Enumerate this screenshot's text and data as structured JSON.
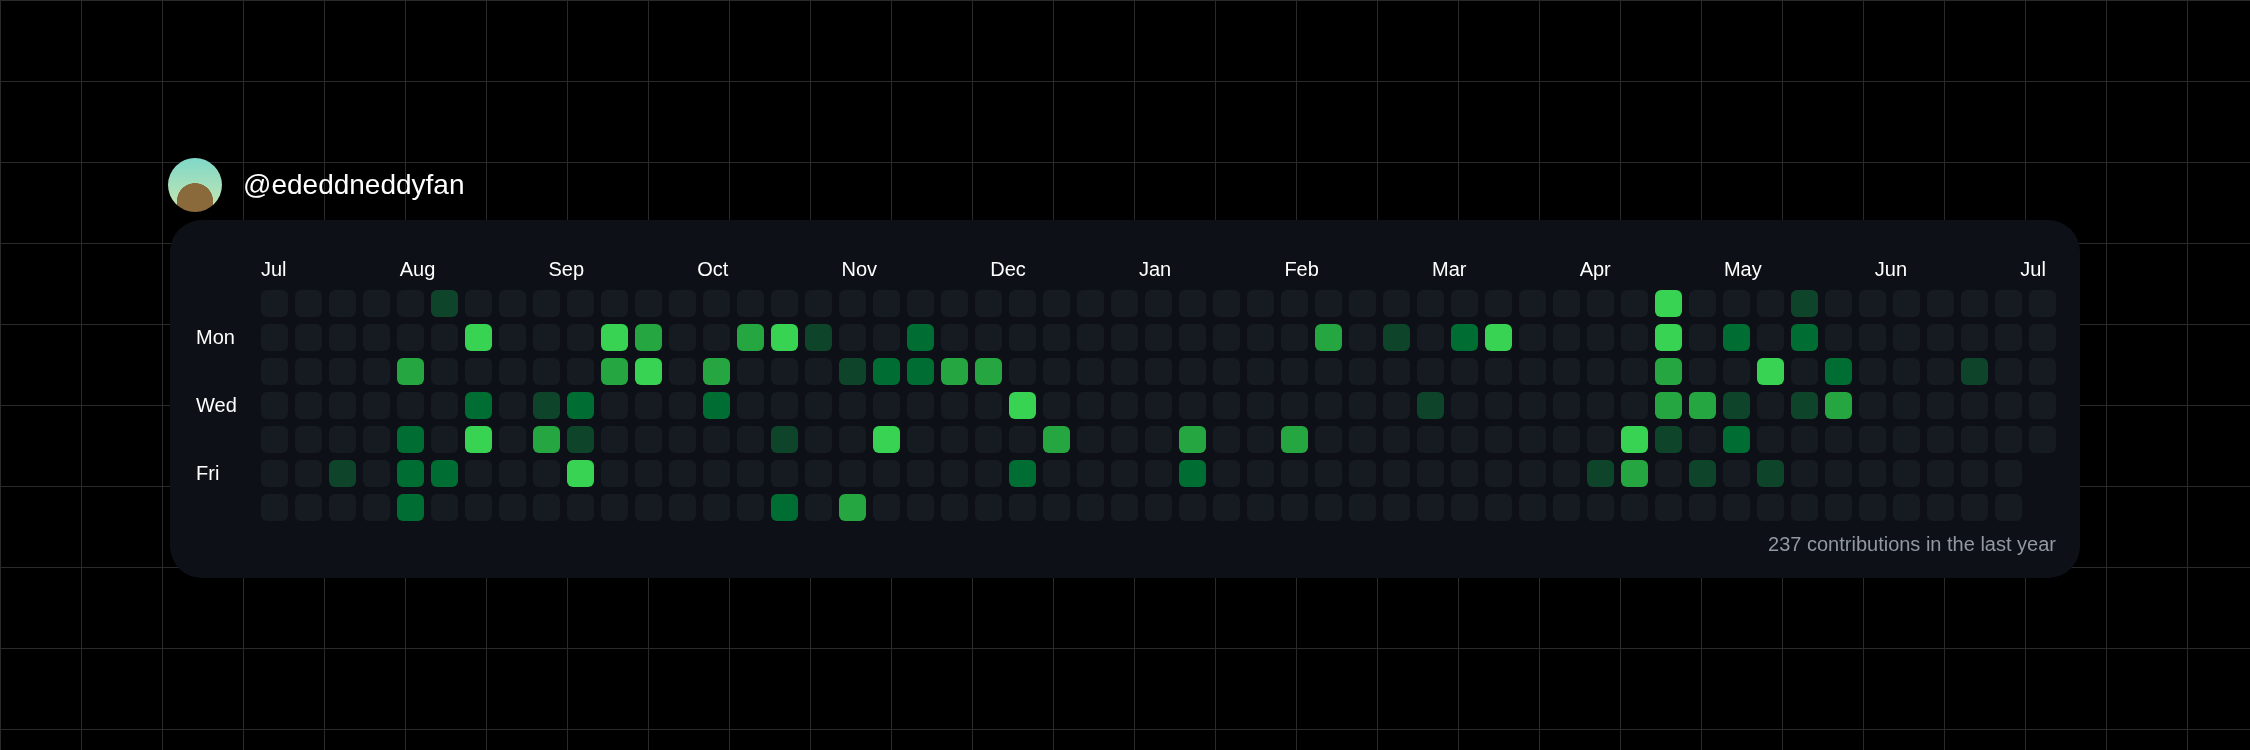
{
  "profile": {
    "username": "@ededdneddyfan"
  },
  "calendar": {
    "months": [
      "Jul",
      "Aug",
      "Sep",
      "Oct",
      "Nov",
      "Dec",
      "Jan",
      "Feb",
      "Mar",
      "Apr",
      "May",
      "Jun",
      "Jul"
    ],
    "day_labels": [
      "Mon",
      "Wed",
      "Fri"
    ],
    "weeks": [
      {
        "days": [
          {
            "color": "#161b22"
          },
          {
            "color": "#161b22"
          },
          {
            "color": "#161b22"
          },
          {
            "color": "#161b22"
          },
          {
            "color": "#161b22"
          },
          {
            "color": "#161b22"
          },
          {
            "color": "#161b22"
          }
        ]
      },
      {
        "days": [
          {
            "color": "#161b22"
          },
          {
            "color": "#161b22"
          },
          {
            "color": "#161b22"
          },
          {
            "color": "#161b22"
          },
          {
            "color": "#161b22"
          },
          {
            "color": "#161b22"
          },
          {
            "color": "#161b22"
          }
        ]
      },
      {
        "days": [
          {
            "color": "#161b22"
          },
          {
            "color": "#161b22"
          },
          {
            "color": "#161b22"
          },
          {
            "color": "#161b22"
          },
          {
            "color": "#161b22"
          },
          {
            "color": "#0e4429"
          },
          {
            "color": "#161b22"
          }
        ]
      },
      {
        "days": [
          {
            "color": "#161b22"
          },
          {
            "color": "#161b22"
          },
          {
            "color": "#161b22"
          },
          {
            "color": "#161b22"
          },
          {
            "color": "#161b22"
          },
          {
            "color": "#161b22"
          },
          {
            "color": "#161b22"
          }
        ]
      },
      {
        "days": [
          {
            "color": "#161b22"
          },
          {
            "color": "#161b22"
          },
          {
            "color": "#26a641"
          },
          {
            "color": "#161b22"
          },
          {
            "color": "#006d32"
          },
          {
            "color": "#006d32"
          },
          {
            "color": "#006d32"
          }
        ]
      },
      {
        "days": [
          {
            "color": "#0e4429"
          },
          {
            "color": "#161b22"
          },
          {
            "color": "#161b22"
          },
          {
            "color": "#161b22"
          },
          {
            "color": "#161b22"
          },
          {
            "color": "#006d32"
          },
          {
            "color": "#161b22"
          }
        ]
      },
      {
        "days": [
          {
            "color": "#161b22"
          },
          {
            "color": "#39d353"
          },
          {
            "color": "#161b22"
          },
          {
            "color": "#006d32"
          },
          {
            "color": "#39d353"
          },
          {
            "color": "#161b22"
          },
          {
            "color": "#161b22"
          }
        ]
      },
      {
        "days": [
          {
            "color": "#161b22"
          },
          {
            "color": "#161b22"
          },
          {
            "color": "#161b22"
          },
          {
            "color": "#161b22"
          },
          {
            "color": "#161b22"
          },
          {
            "color": "#161b22"
          },
          {
            "color": "#161b22"
          }
        ]
      },
      {
        "days": [
          {
            "color": "#161b22"
          },
          {
            "color": "#161b22"
          },
          {
            "color": "#161b22"
          },
          {
            "color": "#0e4429"
          },
          {
            "color": "#26a641"
          },
          {
            "color": "#161b22"
          },
          {
            "color": "#161b22"
          }
        ]
      },
      {
        "days": [
          {
            "color": "#161b22"
          },
          {
            "color": "#161b22"
          },
          {
            "color": "#161b22"
          },
          {
            "color": "#006d32"
          },
          {
            "color": "#0e4429"
          },
          {
            "color": "#39d353"
          },
          {
            "color": "#161b22"
          }
        ]
      },
      {
        "days": [
          {
            "color": "#161b22"
          },
          {
            "color": "#39d353"
          },
          {
            "color": "#26a641"
          },
          {
            "color": "#161b22"
          },
          {
            "color": "#161b22"
          },
          {
            "color": "#161b22"
          },
          {
            "color": "#161b22"
          }
        ]
      },
      {
        "days": [
          {
            "color": "#161b22"
          },
          {
            "color": "#26a641"
          },
          {
            "color": "#39d353"
          },
          {
            "color": "#161b22"
          },
          {
            "color": "#161b22"
          },
          {
            "color": "#161b22"
          },
          {
            "color": "#161b22"
          }
        ]
      },
      {
        "days": [
          {
            "color": "#161b22"
          },
          {
            "color": "#161b22"
          },
          {
            "color": "#161b22"
          },
          {
            "color": "#161b22"
          },
          {
            "color": "#161b22"
          },
          {
            "color": "#161b22"
          },
          {
            "color": "#161b22"
          }
        ]
      },
      {
        "days": [
          {
            "color": "#161b22"
          },
          {
            "color": "#161b22"
          },
          {
            "color": "#26a641"
          },
          {
            "color": "#006d32"
          },
          {
            "color": "#161b22"
          },
          {
            "color": "#161b22"
          },
          {
            "color": "#161b22"
          }
        ]
      },
      {
        "days": [
          {
            "color": "#161b22"
          },
          {
            "color": "#26a641"
          },
          {
            "color": "#161b22"
          },
          {
            "color": "#161b22"
          },
          {
            "color": "#161b22"
          },
          {
            "color": "#161b22"
          },
          {
            "color": "#161b22"
          }
        ]
      },
      {
        "days": [
          {
            "color": "#161b22"
          },
          {
            "color": "#39d353"
          },
          {
            "color": "#161b22"
          },
          {
            "color": "#161b22"
          },
          {
            "color": "#0e4429"
          },
          {
            "color": "#161b22"
          },
          {
            "color": "#006d32"
          }
        ]
      },
      {
        "days": [
          {
            "color": "#161b22"
          },
          {
            "color": "#0e4429"
          },
          {
            "color": "#161b22"
          },
          {
            "color": "#161b22"
          },
          {
            "color": "#161b22"
          },
          {
            "color": "#161b22"
          },
          {
            "color": "#161b22"
          }
        ]
      },
      {
        "days": [
          {
            "color": "#161b22"
          },
          {
            "color": "#161b22"
          },
          {
            "color": "#0e4429"
          },
          {
            "color": "#161b22"
          },
          {
            "color": "#161b22"
          },
          {
            "color": "#161b22"
          },
          {
            "color": "#26a641"
          }
        ]
      },
      {
        "days": [
          {
            "color": "#161b22"
          },
          {
            "color": "#161b22"
          },
          {
            "color": "#006d32"
          },
          {
            "color": "#161b22"
          },
          {
            "color": "#39d353"
          },
          {
            "color": "#161b22"
          },
          {
            "color": "#161b22"
          }
        ]
      },
      {
        "days": [
          {
            "color": "#161b22"
          },
          {
            "color": "#006d32"
          },
          {
            "color": "#006d32"
          },
          {
            "color": "#161b22"
          },
          {
            "color": "#161b22"
          },
          {
            "color": "#161b22"
          },
          {
            "color": "#161b22"
          }
        ]
      },
      {
        "days": [
          {
            "color": "#161b22"
          },
          {
            "color": "#161b22"
          },
          {
            "color": "#26a641"
          },
          {
            "color": "#161b22"
          },
          {
            "color": "#161b22"
          },
          {
            "color": "#161b22"
          },
          {
            "color": "#161b22"
          }
        ]
      },
      {
        "days": [
          {
            "color": "#161b22"
          },
          {
            "color": "#161b22"
          },
          {
            "color": "#26a641"
          },
          {
            "color": "#161b22"
          },
          {
            "color": "#161b22"
          },
          {
            "color": "#161b22"
          },
          {
            "color": "#161b22"
          }
        ]
      },
      {
        "days": [
          {
            "color": "#161b22"
          },
          {
            "color": "#161b22"
          },
          {
            "color": "#161b22"
          },
          {
            "color": "#39d353"
          },
          {
            "color": "#161b22"
          },
          {
            "color": "#006d32"
          },
          {
            "color": "#161b22"
          }
        ]
      },
      {
        "days": [
          {
            "color": "#161b22"
          },
          {
            "color": "#161b22"
          },
          {
            "color": "#161b22"
          },
          {
            "color": "#161b22"
          },
          {
            "color": "#26a641"
          },
          {
            "color": "#161b22"
          },
          {
            "color": "#161b22"
          }
        ]
      },
      {
        "days": [
          {
            "color": "#161b22"
          },
          {
            "color": "#161b22"
          },
          {
            "color": "#161b22"
          },
          {
            "color": "#161b22"
          },
          {
            "color": "#161b22"
          },
          {
            "color": "#161b22"
          },
          {
            "color": "#161b22"
          }
        ]
      },
      {
        "days": [
          {
            "color": "#161b22"
          },
          {
            "color": "#161b22"
          },
          {
            "color": "#161b22"
          },
          {
            "color": "#161b22"
          },
          {
            "color": "#161b22"
          },
          {
            "color": "#161b22"
          },
          {
            "color": "#161b22"
          }
        ]
      },
      {
        "days": [
          {
            "color": "#161b22"
          },
          {
            "color": "#161b22"
          },
          {
            "color": "#161b22"
          },
          {
            "color": "#161b22"
          },
          {
            "color": "#161b22"
          },
          {
            "color": "#161b22"
          },
          {
            "color": "#161b22"
          }
        ]
      },
      {
        "days": [
          {
            "color": "#161b22"
          },
          {
            "color": "#161b22"
          },
          {
            "color": "#161b22"
          },
          {
            "color": "#161b22"
          },
          {
            "color": "#26a641"
          },
          {
            "color": "#006d32"
          },
          {
            "color": "#161b22"
          }
        ]
      },
      {
        "days": [
          {
            "color": "#161b22"
          },
          {
            "color": "#161b22"
          },
          {
            "color": "#161b22"
          },
          {
            "color": "#161b22"
          },
          {
            "color": "#161b22"
          },
          {
            "color": "#161b22"
          },
          {
            "color": "#161b22"
          }
        ]
      },
      {
        "days": [
          {
            "color": "#161b22"
          },
          {
            "color": "#161b22"
          },
          {
            "color": "#161b22"
          },
          {
            "color": "#161b22"
          },
          {
            "color": "#161b22"
          },
          {
            "color": "#161b22"
          },
          {
            "color": "#161b22"
          }
        ]
      },
      {
        "days": [
          {
            "color": "#161b22"
          },
          {
            "color": "#161b22"
          },
          {
            "color": "#161b22"
          },
          {
            "color": "#161b22"
          },
          {
            "color": "#26a641"
          },
          {
            "color": "#161b22"
          },
          {
            "color": "#161b22"
          }
        ]
      },
      {
        "days": [
          {
            "color": "#161b22"
          },
          {
            "color": "#26a641"
          },
          {
            "color": "#161b22"
          },
          {
            "color": "#161b22"
          },
          {
            "color": "#161b22"
          },
          {
            "color": "#161b22"
          },
          {
            "color": "#161b22"
          }
        ]
      },
      {
        "days": [
          {
            "color": "#161b22"
          },
          {
            "color": "#161b22"
          },
          {
            "color": "#161b22"
          },
          {
            "color": "#161b22"
          },
          {
            "color": "#161b22"
          },
          {
            "color": "#161b22"
          },
          {
            "color": "#161b22"
          }
        ]
      },
      {
        "days": [
          {
            "color": "#161b22"
          },
          {
            "color": "#0e4429"
          },
          {
            "color": "#161b22"
          },
          {
            "color": "#161b22"
          },
          {
            "color": "#161b22"
          },
          {
            "color": "#161b22"
          },
          {
            "color": "#161b22"
          }
        ]
      },
      {
        "days": [
          {
            "color": "#161b22"
          },
          {
            "color": "#161b22"
          },
          {
            "color": "#161b22"
          },
          {
            "color": "#0e4429"
          },
          {
            "color": "#161b22"
          },
          {
            "color": "#161b22"
          },
          {
            "color": "#161b22"
          }
        ]
      },
      {
        "days": [
          {
            "color": "#161b22"
          },
          {
            "color": "#006d32"
          },
          {
            "color": "#161b22"
          },
          {
            "color": "#161b22"
          },
          {
            "color": "#161b22"
          },
          {
            "color": "#161b22"
          },
          {
            "color": "#161b22"
          }
        ]
      },
      {
        "days": [
          {
            "color": "#161b22"
          },
          {
            "color": "#39d353"
          },
          {
            "color": "#161b22"
          },
          {
            "color": "#161b22"
          },
          {
            "color": "#161b22"
          },
          {
            "color": "#161b22"
          },
          {
            "color": "#161b22"
          }
        ]
      },
      {
        "days": [
          {
            "color": "#161b22"
          },
          {
            "color": "#161b22"
          },
          {
            "color": "#161b22"
          },
          {
            "color": "#161b22"
          },
          {
            "color": "#161b22"
          },
          {
            "color": "#161b22"
          },
          {
            "color": "#161b22"
          }
        ]
      },
      {
        "days": [
          {
            "color": "#161b22"
          },
          {
            "color": "#161b22"
          },
          {
            "color": "#161b22"
          },
          {
            "color": "#161b22"
          },
          {
            "color": "#161b22"
          },
          {
            "color": "#161b22"
          },
          {
            "color": "#161b22"
          }
        ]
      },
      {
        "days": [
          {
            "color": "#161b22"
          },
          {
            "color": "#161b22"
          },
          {
            "color": "#161b22"
          },
          {
            "color": "#161b22"
          },
          {
            "color": "#161b22"
          },
          {
            "color": "#0e4429"
          },
          {
            "color": "#161b22"
          }
        ]
      },
      {
        "days": [
          {
            "color": "#161b22"
          },
          {
            "color": "#161b22"
          },
          {
            "color": "#161b22"
          },
          {
            "color": "#161b22"
          },
          {
            "color": "#39d353"
          },
          {
            "color": "#26a641"
          },
          {
            "color": "#161b22"
          }
        ]
      },
      {
        "days": [
          {
            "color": "#39d353"
          },
          {
            "color": "#39d353"
          },
          {
            "color": "#26a641"
          },
          {
            "color": "#26a641"
          },
          {
            "color": "#0e4429"
          },
          {
            "color": "#161b22"
          },
          {
            "color": "#161b22"
          }
        ]
      },
      {
        "days": [
          {
            "color": "#161b22"
          },
          {
            "color": "#161b22"
          },
          {
            "color": "#161b22"
          },
          {
            "color": "#26a641"
          },
          {
            "color": "#161b22"
          },
          {
            "color": "#0e4429"
          },
          {
            "color": "#161b22"
          }
        ]
      },
      {
        "days": [
          {
            "color": "#161b22"
          },
          {
            "color": "#006d32"
          },
          {
            "color": "#161b22"
          },
          {
            "color": "#0e4429"
          },
          {
            "color": "#006d32"
          },
          {
            "color": "#161b22"
          },
          {
            "color": "#161b22"
          }
        ]
      },
      {
        "days": [
          {
            "color": "#161b22"
          },
          {
            "color": "#161b22"
          },
          {
            "color": "#39d353"
          },
          {
            "color": "#161b22"
          },
          {
            "color": "#161b22"
          },
          {
            "color": "#0e4429"
          },
          {
            "color": "#161b22"
          }
        ]
      },
      {
        "days": [
          {
            "color": "#0e4429"
          },
          {
            "color": "#006d32"
          },
          {
            "color": "#161b22"
          },
          {
            "color": "#0e4429"
          },
          {
            "color": "#161b22"
          },
          {
            "color": "#161b22"
          },
          {
            "color": "#161b22"
          }
        ]
      },
      {
        "days": [
          {
            "color": "#161b22"
          },
          {
            "color": "#161b22"
          },
          {
            "color": "#006d32"
          },
          {
            "color": "#26a641"
          },
          {
            "color": "#161b22"
          },
          {
            "color": "#161b22"
          },
          {
            "color": "#161b22"
          }
        ]
      },
      {
        "days": [
          {
            "color": "#161b22"
          },
          {
            "color": "#161b22"
          },
          {
            "color": "#161b22"
          },
          {
            "color": "#161b22"
          },
          {
            "color": "#161b22"
          },
          {
            "color": "#161b22"
          },
          {
            "color": "#161b22"
          }
        ]
      },
      {
        "days": [
          {
            "color": "#161b22"
          },
          {
            "color": "#161b22"
          },
          {
            "color": "#161b22"
          },
          {
            "color": "#161b22"
          },
          {
            "color": "#161b22"
          },
          {
            "color": "#161b22"
          },
          {
            "color": "#161b22"
          }
        ]
      },
      {
        "days": [
          {
            "color": "#161b22"
          },
          {
            "color": "#161b22"
          },
          {
            "color": "#161b22"
          },
          {
            "color": "#161b22"
          },
          {
            "color": "#161b22"
          },
          {
            "color": "#161b22"
          },
          {
            "color": "#161b22"
          }
        ]
      },
      {
        "days": [
          {
            "color": "#161b22"
          },
          {
            "color": "#161b22"
          },
          {
            "color": "#0e4429"
          },
          {
            "color": "#161b22"
          },
          {
            "color": "#161b22"
          },
          {
            "color": "#161b22"
          },
          {
            "color": "#161b22"
          }
        ]
      },
      {
        "days": [
          {
            "color": "#161b22"
          },
          {
            "color": "#161b22"
          },
          {
            "color": "#161b22"
          },
          {
            "color": "#161b22"
          },
          {
            "color": "#161b22"
          },
          {
            "color": "#161b22"
          },
          {
            "color": "#161b22"
          }
        ]
      },
      {
        "days": [
          {
            "color": "#161b22"
          },
          {
            "color": "#161b22"
          },
          {
            "color": "#161b22"
          },
          {
            "color": "#161b22"
          },
          {
            "color": "#161b22"
          }
        ]
      }
    ],
    "summary": "237 contributions in the last year"
  }
}
